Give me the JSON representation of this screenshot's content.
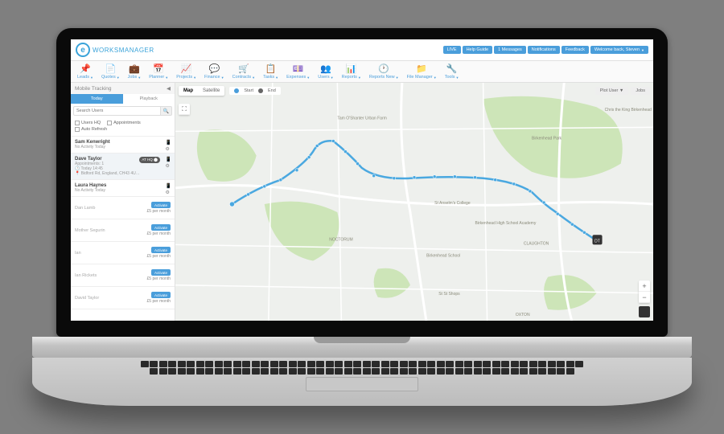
{
  "brand": {
    "name": "WORKSMANAGER"
  },
  "topButtons": [
    {
      "label": "LIVE"
    },
    {
      "label": "Help Guide"
    },
    {
      "label": "1 Messages"
    },
    {
      "label": "Notifications"
    },
    {
      "label": "Feedback"
    },
    {
      "label": "Welcome back, Steven"
    }
  ],
  "nav": [
    {
      "icon": "📌",
      "label": "Leads"
    },
    {
      "icon": "📄",
      "label": "Quotes"
    },
    {
      "icon": "💼",
      "label": "Jobs"
    },
    {
      "icon": "📅",
      "label": "Planner"
    },
    {
      "icon": "📈",
      "label": "Projects"
    },
    {
      "icon": "💬",
      "label": "Finance"
    },
    {
      "icon": "🛒",
      "label": "Contracts"
    },
    {
      "icon": "📋",
      "label": "Tasks"
    },
    {
      "icon": "💷",
      "label": "Expenses"
    },
    {
      "icon": "👥",
      "label": "Users"
    },
    {
      "icon": "📊",
      "label": "Reports"
    },
    {
      "icon": "🕐",
      "label": "Reports New"
    },
    {
      "icon": "📁",
      "label": "File Manager"
    },
    {
      "icon": "🔧",
      "label": "Tools"
    }
  ],
  "sidebar": {
    "title": "Mobile Tracking",
    "tabs": {
      "active": "Today",
      "other": "Playback"
    },
    "search": {
      "placeholder": "Search Users"
    },
    "filters": {
      "usersHQ": "Users HQ",
      "appointments": "Appointments",
      "autoRefresh": "Auto Refresh"
    },
    "activeUsers": [
      {
        "name": "Sam Kenwright",
        "sub": "No Activity Today"
      },
      {
        "name": "Dave Taylor",
        "sub": "Appointments: 1",
        "sub2": "Today 14:45",
        "sub3": "Bidford Rd, England, CH43 4U…",
        "badge": "AT HQ",
        "selected": true
      },
      {
        "name": "Laura Haynes",
        "sub": "No Activity Today"
      }
    ],
    "inactiveUsers": [
      {
        "name": "Dan Lamb"
      },
      {
        "name": "Mother Segurin"
      },
      {
        "name": "Ian"
      },
      {
        "name": "Ian Rickets"
      },
      {
        "name": "David Taylor"
      }
    ],
    "activateLabel": "Activate",
    "priceLabel": "£5 per month"
  },
  "map": {
    "types": {
      "map": "Map",
      "satellite": "Satellite"
    },
    "legend": {
      "start": "Start",
      "end": "End"
    },
    "rightControls": {
      "plotUser": "Plot User",
      "jobs": "Jobs"
    },
    "labels": {
      "noctorum": "NOCTORUM",
      "claughton": "CLAUGHTON",
      "oxton": "OXTON",
      "birkenheadPark": "Birkenhead Park",
      "tamOShanter": "Tam O'Shanter Urban Farm",
      "stAnselms": "St Anselm's College",
      "schoolAcademy": "Birkenhead High School Academy",
      "birkenheadSchool": "Birkenhead School",
      "stSt": "St St Shops",
      "chrisKing": "Chris the King Birkenhead"
    },
    "endLabel": "DT"
  }
}
